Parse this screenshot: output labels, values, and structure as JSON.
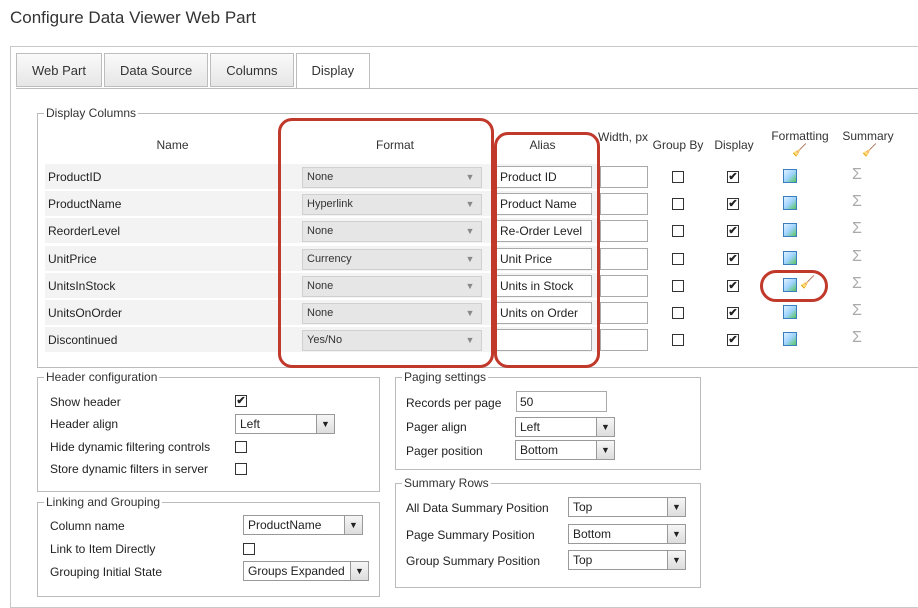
{
  "page": {
    "title": "Configure Data Viewer Web Part"
  },
  "tabs": [
    {
      "label": "Web Part"
    },
    {
      "label": "Data Source"
    },
    {
      "label": "Columns"
    },
    {
      "label": "Display"
    }
  ],
  "display_columns": {
    "legend": "Display Columns",
    "headers": {
      "name": "Name",
      "format": "Format",
      "alias": "Alias",
      "width": "Width, px",
      "group_by": "Group By",
      "display": "Display",
      "formatting": "Formatting",
      "summary": "Summary"
    },
    "rows": [
      {
        "name": "ProductID",
        "format": "None",
        "alias": "Product ID",
        "width": "",
        "group_by": false,
        "display": true
      },
      {
        "name": "ProductName",
        "format": "Hyperlink",
        "alias": "Product Name",
        "width": "",
        "group_by": false,
        "display": true
      },
      {
        "name": "ReorderLevel",
        "format": "None",
        "alias": "Re-Order Level",
        "width": "",
        "group_by": false,
        "display": true
      },
      {
        "name": "UnitPrice",
        "format": "Currency",
        "alias": "Unit Price",
        "width": "",
        "group_by": false,
        "display": true
      },
      {
        "name": "UnitsInStock",
        "format": "None",
        "alias": "Units in Stock",
        "width": "",
        "group_by": false,
        "display": true
      },
      {
        "name": "UnitsOnOrder",
        "format": "None",
        "alias": "Units on Order",
        "width": "",
        "group_by": false,
        "display": true
      },
      {
        "name": "Discontinued",
        "format": "Yes/No",
        "alias": "",
        "width": "",
        "group_by": false,
        "display": true
      }
    ]
  },
  "header_config": {
    "legend": "Header configuration",
    "show_header_label": "Show header",
    "show_header": true,
    "header_align_label": "Header align",
    "header_align": "Left",
    "hide_dynamic_label": "Hide dynamic filtering controls",
    "hide_dynamic": false,
    "store_dynamic_label": "Store dynamic filters in server",
    "store_dynamic": false
  },
  "linking": {
    "legend": "Linking and Grouping",
    "column_name_label": "Column name",
    "column_name": "ProductName",
    "link_label": "Link to Item Directly",
    "link": false,
    "grouping_label": "Grouping Initial State",
    "grouping": "Groups Expanded"
  },
  "paging": {
    "legend": "Paging settings",
    "records_label": "Records per page",
    "records": "50",
    "pager_align_label": "Pager align",
    "pager_align": "Left",
    "pager_position_label": "Pager position",
    "pager_position": "Bottom"
  },
  "summary_rows": {
    "legend": "Summary Rows",
    "all_label": "All Data Summary Position",
    "all": "Top",
    "page_label": "Page Summary Position",
    "page": "Bottom",
    "group_label": "Group Summary Position",
    "group": "Top"
  },
  "icons": {
    "check": "✔",
    "sigma": "Σ",
    "arrow": "▼"
  },
  "colors": {
    "highlight": "#c0392b"
  }
}
